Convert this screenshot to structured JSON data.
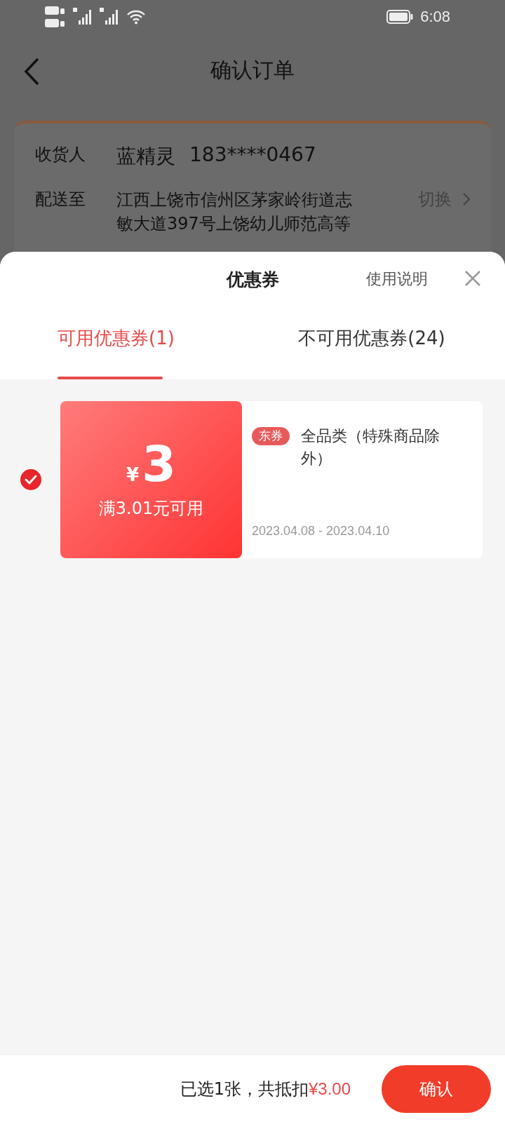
{
  "status_bar": {
    "time": "6:08"
  },
  "header": {
    "title": "确认订单"
  },
  "address": {
    "recipient_label": "收货人",
    "recipient_name": "蓝精灵",
    "phone": "183****0467",
    "ship_label": "配送至",
    "address": "江西上饶市信州区茅家岭街道志敏大道397号上饶幼儿师范高等",
    "switch": "切换"
  },
  "sheet": {
    "title": "优惠券",
    "help": "使用说明",
    "tabs": [
      {
        "label": "可用优惠券(1)",
        "selected": true
      },
      {
        "label": "不可用优惠券(24)",
        "selected": false
      }
    ],
    "coupons": [
      {
        "currency": "¥",
        "amount": "3",
        "condition": "满3.01元可用",
        "tag": "东券",
        "scope": "全品类（特殊商品除外）",
        "validity": "2023.04.08 - 2023.04.10",
        "selected": true
      }
    ]
  },
  "footer": {
    "summary": "已选1张，共抵扣",
    "total": "¥3.00",
    "confirm": "确认"
  }
}
